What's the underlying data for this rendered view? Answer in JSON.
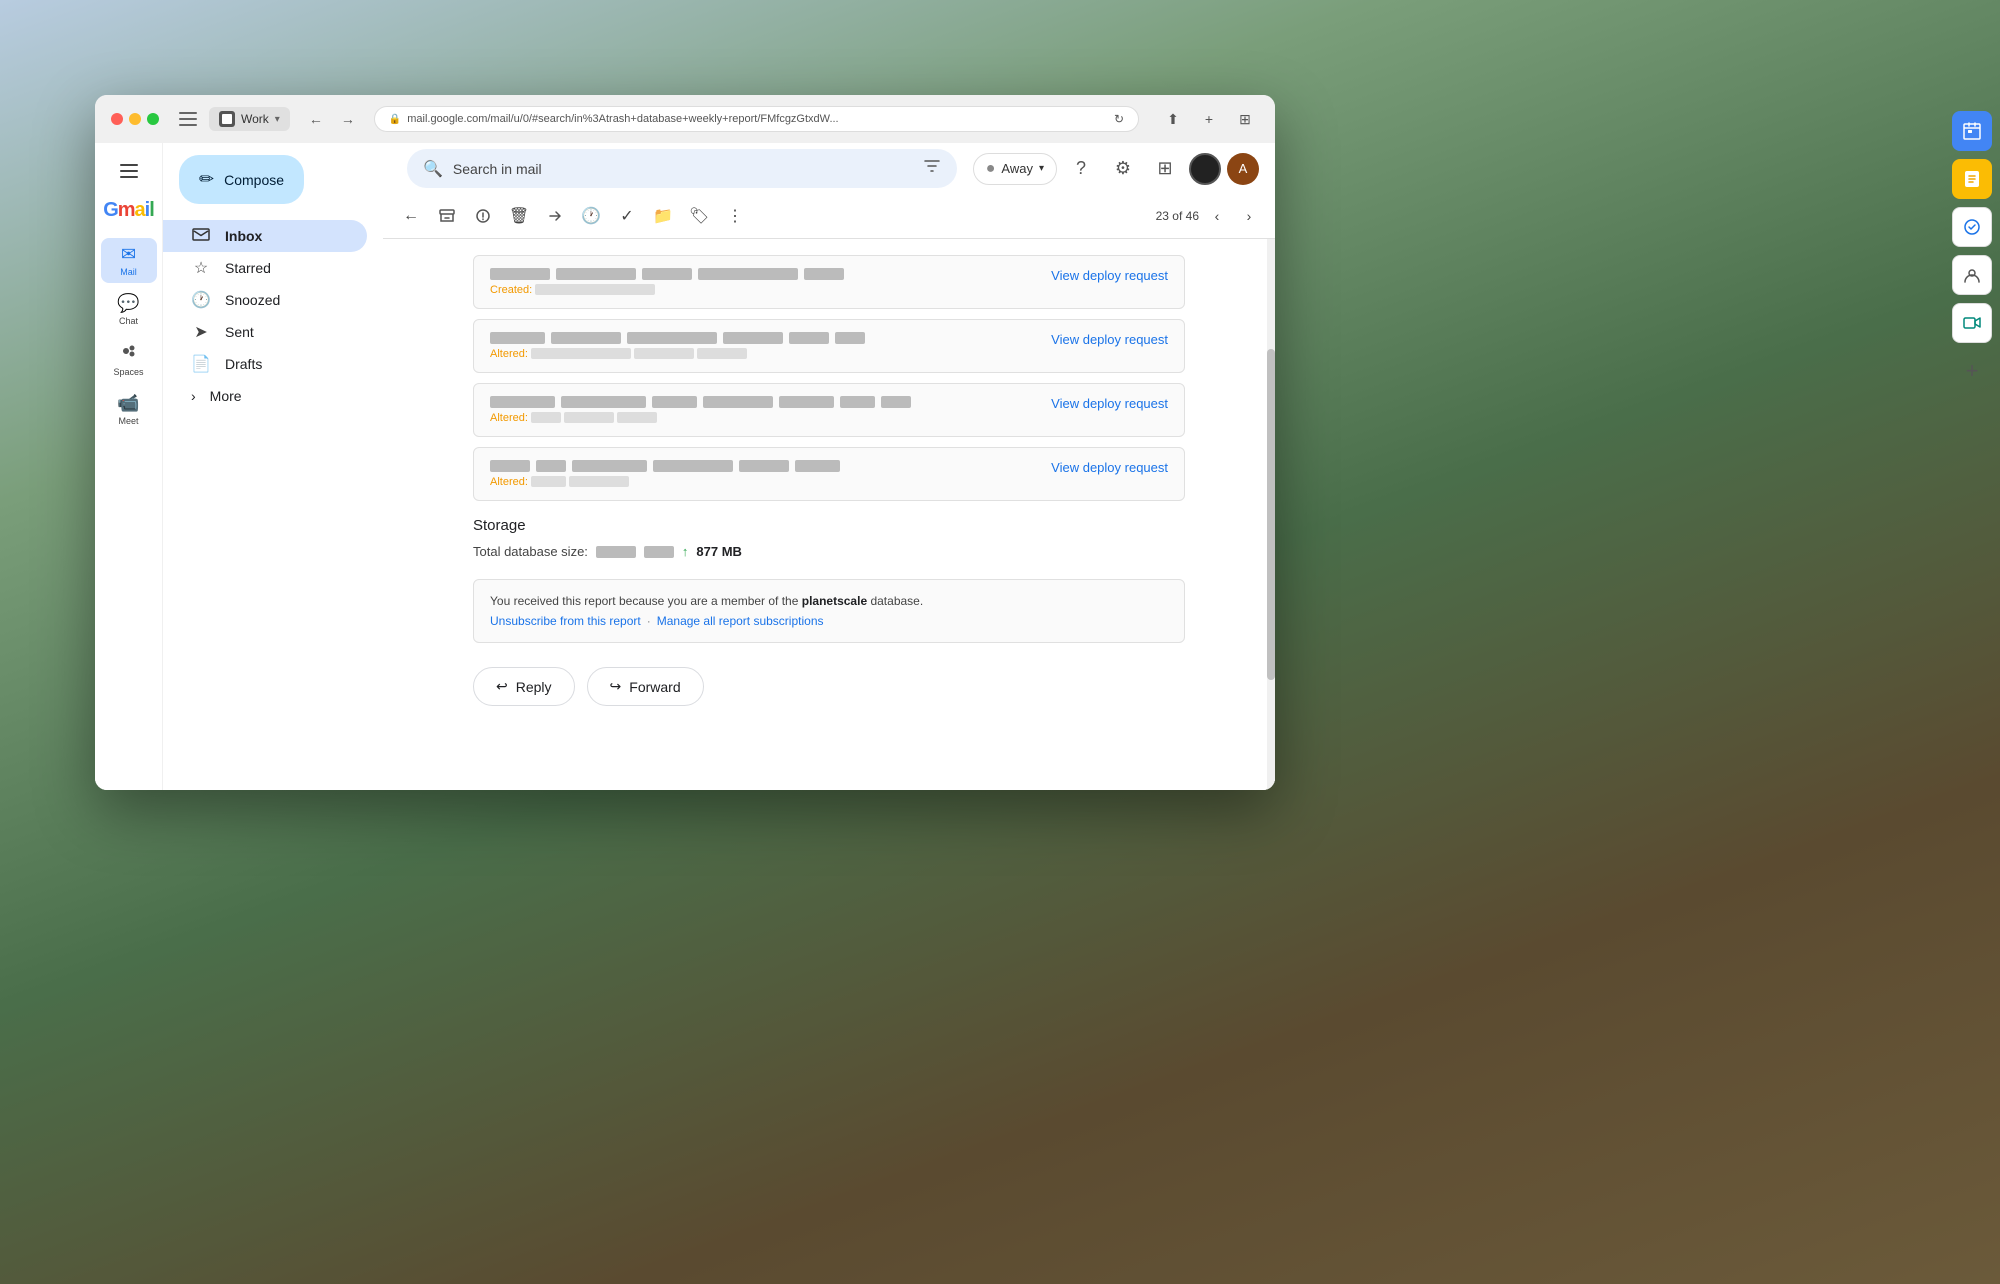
{
  "desktop": {
    "browser": {
      "traffic_lights": [
        "red",
        "yellow",
        "green"
      ],
      "workspace_label": "Work",
      "url": "mail.google.com/mail/u/0/#search/in%3Atrash+database+weekly+report/FMfcgzGtxdW...",
      "nav_back_label": "←",
      "nav_forward_label": "→"
    }
  },
  "gmail": {
    "logo": "Gmail",
    "search_placeholder": "Search in mail",
    "away_label": "Away",
    "sidebar_items": [
      {
        "id": "mail",
        "label": "Mail",
        "icon": "✉"
      },
      {
        "id": "chat",
        "label": "Chat",
        "icon": "💬"
      },
      {
        "id": "spaces",
        "label": "Spaces",
        "icon": "👥"
      },
      {
        "id": "meet",
        "label": "Meet",
        "icon": "📹"
      }
    ],
    "nav": {
      "compose_label": "Compose",
      "items": [
        {
          "id": "inbox",
          "label": "Inbox",
          "icon": "📥",
          "active": true
        },
        {
          "id": "starred",
          "label": "Starred",
          "icon": "☆"
        },
        {
          "id": "snoozed",
          "label": "Snoozed",
          "icon": "🕐"
        },
        {
          "id": "sent",
          "label": "Sent",
          "icon": "➤"
        },
        {
          "id": "drafts",
          "label": "Drafts",
          "icon": "📄"
        },
        {
          "id": "more",
          "label": "More",
          "icon": "›"
        }
      ]
    },
    "toolbar": {
      "back_label": "←",
      "archive_label": "🗃",
      "spam_label": "⚠",
      "delete_label": "🗑",
      "move_label": "→",
      "snooze_label": "🕐",
      "mark_done_label": "✓",
      "move_to_label": "📁",
      "label_label": "🏷",
      "more_label": "⋮",
      "pagination": "23 of 46",
      "prev_label": "‹",
      "next_label": "›"
    },
    "email": {
      "deploy_rows": [
        {
          "id": "row1",
          "label_prefix": "Created:",
          "link_label": "View deploy request"
        },
        {
          "id": "row2",
          "label_prefix": "Altered:",
          "link_label": "View deploy request"
        },
        {
          "id": "row3",
          "label_prefix": "Altered:",
          "link_label": "View deploy request"
        },
        {
          "id": "row4",
          "label_prefix": "Altered:",
          "link_label": "View deploy request"
        }
      ],
      "storage_title": "Storage",
      "storage_label": "Total database size:",
      "storage_arrow": "↑",
      "storage_value": "877 MB",
      "footer_text": "You received this report because you are a member of the ",
      "footer_bold": "planetscale",
      "footer_suffix": " database.",
      "footer_links": [
        {
          "label": "Unsubscribe from this report",
          "id": "unsubscribe"
        },
        {
          "label": "Manage all report subscriptions",
          "id": "manage"
        }
      ],
      "footer_dot": "·",
      "actions": {
        "reply_label": "Reply",
        "forward_label": "Forward"
      }
    }
  }
}
